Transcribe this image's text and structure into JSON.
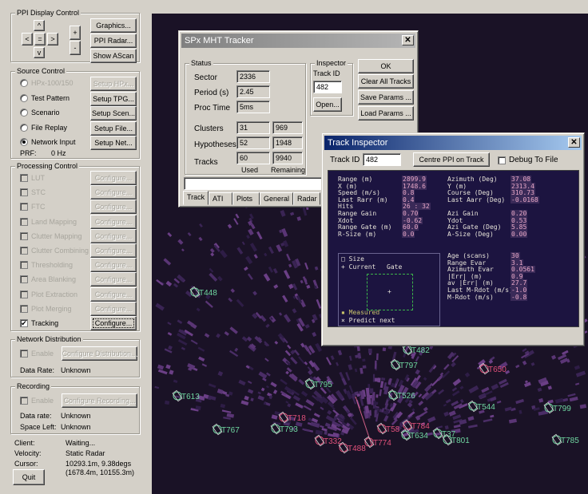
{
  "ppi": {
    "title": "PPI Display Control",
    "graphics": "Graphics...",
    "ppi_radar": "PPI Radar...",
    "show_ascan": "Show AScan",
    "arrow_up": "^",
    "arrow_left": "<",
    "arrow_center": "=",
    "arrow_right": ">",
    "arrow_down": "v",
    "zoom_in": "+",
    "zoom_out": "-"
  },
  "source": {
    "title": "Source Control",
    "items": [
      {
        "label": "HPx-100/150",
        "button": "Setup HPx...",
        "selected": false,
        "enabled": false
      },
      {
        "label": "Test Pattern",
        "button": "Setup TPG...",
        "selected": false,
        "enabled": true
      },
      {
        "label": "Scenario",
        "button": "Setup Scen...",
        "selected": false,
        "enabled": true
      },
      {
        "label": "File Replay",
        "button": "Setup File...",
        "selected": false,
        "enabled": true
      },
      {
        "label": "Network Input",
        "button": "Setup Net...",
        "selected": true,
        "enabled": true
      }
    ],
    "prf_label": "PRF:",
    "prf_value": "0 Hz"
  },
  "processing": {
    "title": "Processing Control",
    "configure": "Configure...",
    "items": [
      {
        "label": "LUT",
        "checked": false,
        "enabled": false
      },
      {
        "label": "STC",
        "checked": false,
        "enabled": false
      },
      {
        "label": "FTC",
        "checked": false,
        "enabled": false
      },
      {
        "label": "Land Mapping",
        "checked": false,
        "enabled": false
      },
      {
        "label": "Clutter Mapping",
        "checked": false,
        "enabled": false
      },
      {
        "label": "Clutter Combining",
        "checked": false,
        "enabled": false
      },
      {
        "label": "Thresholding",
        "checked": false,
        "enabled": false
      },
      {
        "label": "Area Blanking",
        "checked": false,
        "enabled": false
      },
      {
        "label": "Plot Extraction",
        "checked": false,
        "enabled": false
      },
      {
        "label": "Plot Merging",
        "checked": false,
        "enabled": false
      },
      {
        "label": "Tracking",
        "checked": true,
        "enabled": true
      }
    ]
  },
  "network": {
    "title": "Network Distribution",
    "enable": "Enable",
    "configure": "Configure Distribution...",
    "rate_label": "Data Rate:",
    "rate_value": "Unknown"
  },
  "recording": {
    "title": "Recording",
    "enable": "Enable",
    "configure": "Configure Recording...",
    "rate_label": "Data rate:",
    "rate_value": "Unknown",
    "space_label": "Space Left:",
    "space_value": "Unknown"
  },
  "status": {
    "client_label": "Client:",
    "client_value": "Waiting...",
    "velocity_label": "Velocity:",
    "velocity_value": "Static Radar",
    "cursor_label": "Cursor:",
    "cursor_value1": "10293.1m, 9.38degs",
    "cursor_value2": "(1678.4m, 10155.3m)",
    "quit": "Quit"
  },
  "mht": {
    "title": "SPx MHT Tracker",
    "status_title": "Status",
    "sector_label": "Sector",
    "sector": "2336",
    "period_label": "Period (s)",
    "period": "2.45",
    "proc_label": "Proc Time",
    "proc": "5ms",
    "clusters_label": "Clusters",
    "clusters_used": "31",
    "clusters_rem": "969",
    "hyp_label": "Hypotheses",
    "hyp_used": "52",
    "hyp_rem": "1948",
    "tracks_label": "Tracks",
    "tracks_used": "60",
    "tracks_rem": "9940",
    "used_label": "Used",
    "remaining_label": "Remaining",
    "inspector_title": "Inspector",
    "track_id_label": "Track ID",
    "track_id": "482",
    "open": "Open...",
    "ok": "OK",
    "clear_all": "Clear All Tracks",
    "save_params": "Save Params ...",
    "load_params": "Load Params ...",
    "tabs": [
      "Track",
      "ATI",
      "Plots",
      "General",
      "Radar"
    ]
  },
  "inspector": {
    "title": "Track Inspector",
    "track_id_label": "Track ID",
    "track_id": "482",
    "centre": "Centre PPI on Track",
    "debug": "Debug To File",
    "left": [
      [
        "Range (m)",
        "2899.9"
      ],
      [
        "X (m)",
        "1748.6"
      ],
      [
        "Speed (m/s)",
        "0.8"
      ],
      [
        "Last Rarr (m)",
        "0.4"
      ],
      [
        "Hits",
        "26 : 32"
      ],
      [
        "Range Gain",
        "0.70"
      ],
      [
        "Xdot",
        "-0.62"
      ],
      [
        "Range Gate (m)",
        "60.0"
      ],
      [
        "R-Size (m)",
        "0.0"
      ]
    ],
    "right": [
      [
        "Azimuth (Deg)",
        "37.08"
      ],
      [
        "Y (m)",
        "2313.4"
      ],
      [
        "Course (Deg)",
        "310.73"
      ],
      [
        "Last Aarr (Deg)",
        "-0.0168"
      ],
      [
        "",
        ""
      ],
      [
        "Azi Gain",
        "0.20"
      ],
      [
        "Ydot",
        "0.53"
      ],
      [
        "Azi Gate (Deg)",
        "5.85"
      ],
      [
        "A-Size (Deg)",
        "0.00"
      ]
    ],
    "right2": [
      [
        "Age (scans)",
        "30"
      ],
      [
        "Range Evar",
        "3.1"
      ],
      [
        "Azimuth Evar",
        "0.0561"
      ],
      [
        "|Err| (m)",
        "0.9"
      ],
      [
        "av |Err| (m)",
        "27.7"
      ],
      [
        "Last M-Rdot (m/s)",
        "-1.0"
      ],
      [
        "M-Rdot (m/s)",
        "-0.8"
      ]
    ],
    "legend": {
      "size": "Size",
      "current": "Current",
      "gate": "Gate",
      "measured": "Measured",
      "predict": "Predict next"
    }
  },
  "tracks": [
    {
      "id": "T448",
      "color": "#6fd6a0"
    },
    {
      "id": "T482",
      "color": "#6fd6a0"
    },
    {
      "id": "T797",
      "color": "#6fd6a0"
    },
    {
      "id": "T650",
      "color": "#e0507a"
    },
    {
      "id": "T795",
      "color": "#6fd6a0"
    },
    {
      "id": "T613",
      "color": "#6fd6a0"
    },
    {
      "id": "T526",
      "color": "#6fd6a0"
    },
    {
      "id": "T544",
      "color": "#6fd6a0"
    },
    {
      "id": "T799",
      "color": "#6fd6a0"
    },
    {
      "id": "T718",
      "color": "#e0507a"
    },
    {
      "id": "T767",
      "color": "#6fd6a0"
    },
    {
      "id": "T793",
      "color": "#6fd6a0"
    },
    {
      "id": "T784",
      "color": "#e0507a"
    },
    {
      "id": "T58",
      "color": "#e0507a"
    },
    {
      "id": "T634",
      "color": "#6fd6a0"
    },
    {
      "id": "T37",
      "color": "#6fd6a0"
    },
    {
      "id": "T801",
      "color": "#6fd6a0"
    },
    {
      "id": "T785",
      "color": "#6fd6a0"
    },
    {
      "id": "T332",
      "color": "#e0507a"
    },
    {
      "id": "T774",
      "color": "#e0507a"
    },
    {
      "id": "T488",
      "color": "#e0507a"
    }
  ]
}
